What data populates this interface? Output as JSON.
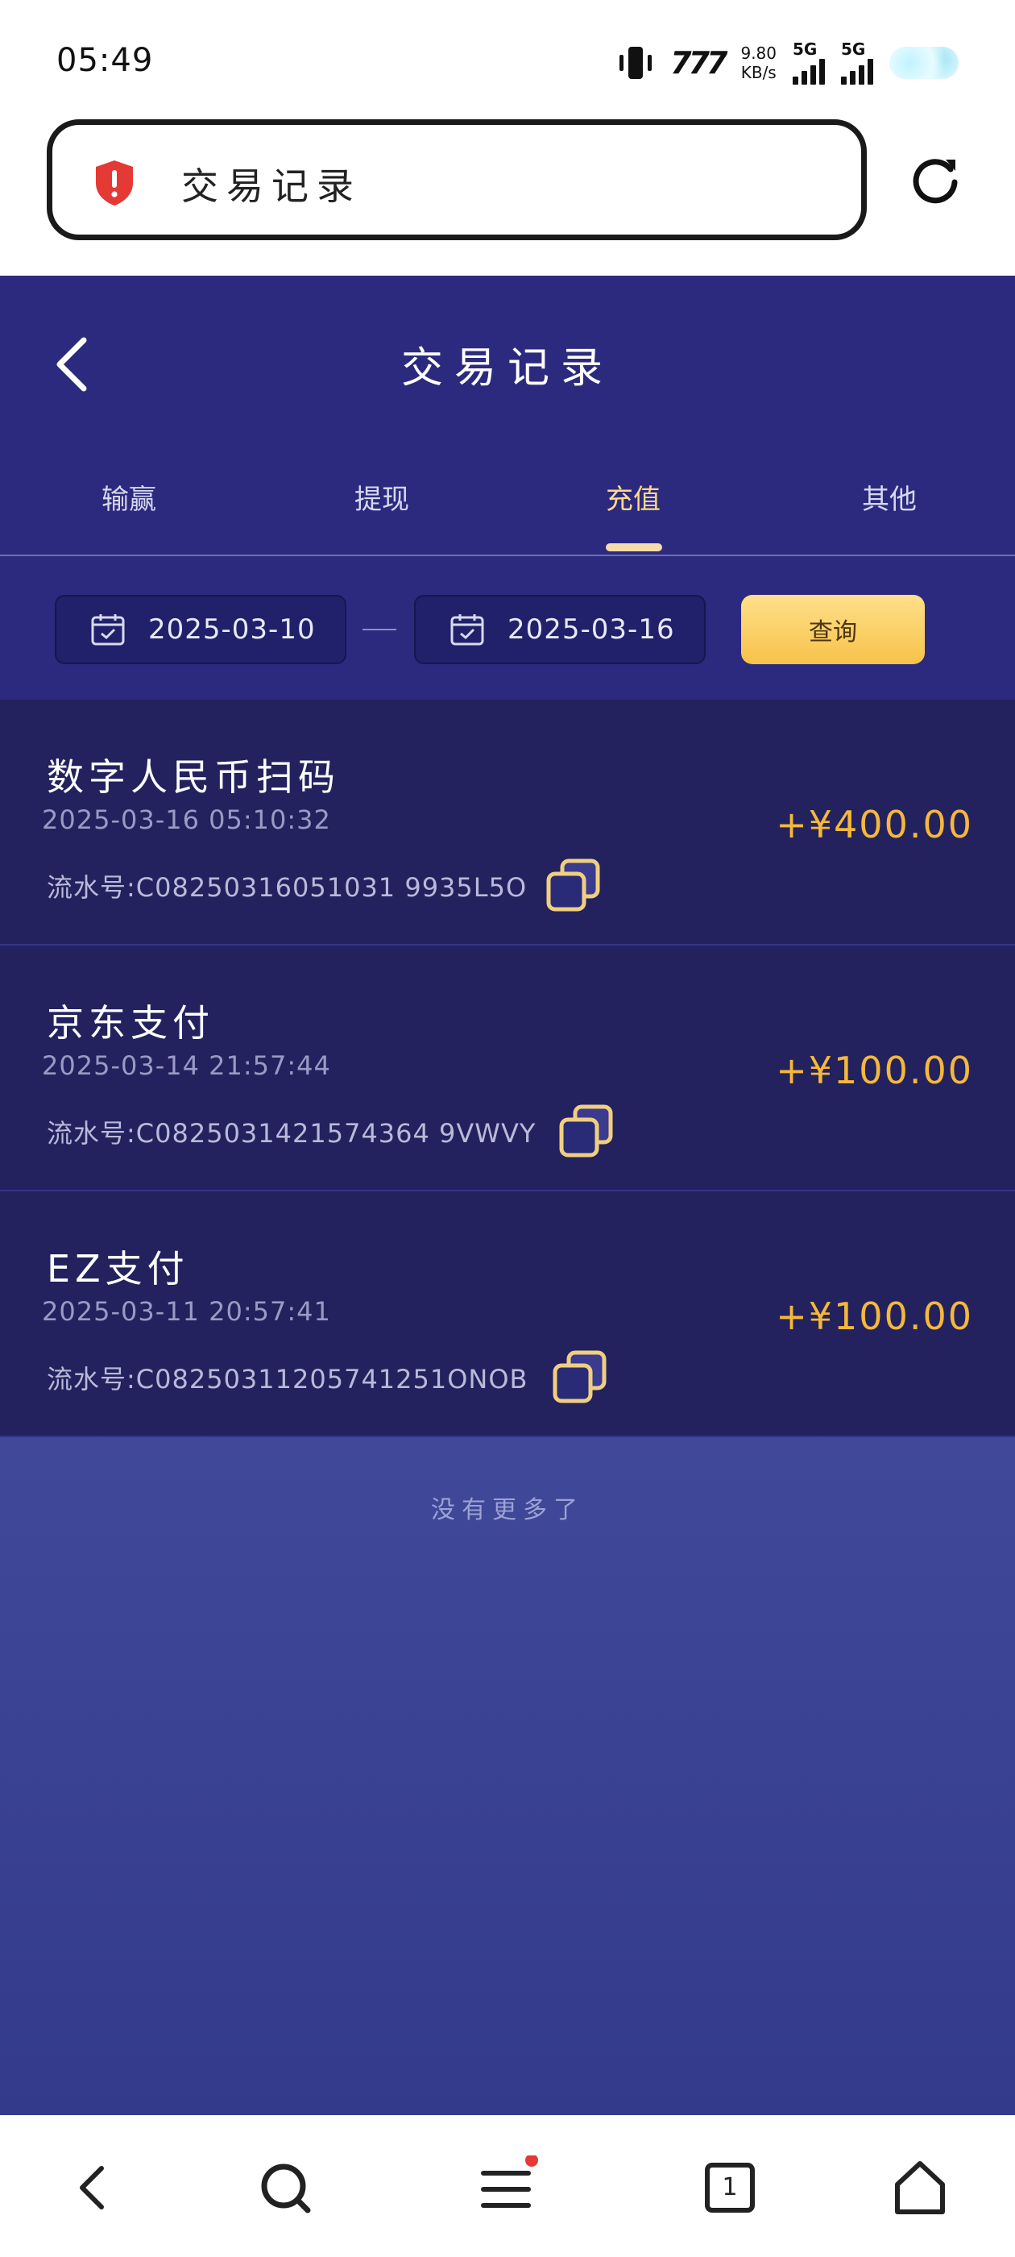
{
  "status_bar": {
    "time": "05:49",
    "network_brand": "777",
    "net_speed_value": "9.80",
    "net_speed_unit": "KB/s",
    "sim1_type": "5G",
    "sim2_type": "5G"
  },
  "browser": {
    "page_title": "交易记录",
    "shield_icon": "shield-alert-icon",
    "reload_icon": "reload-icon"
  },
  "header": {
    "title": "交易记录",
    "back_icon": "chevron-left-icon"
  },
  "tabs": [
    {
      "label": "输赢",
      "active": false
    },
    {
      "label": "提现",
      "active": false
    },
    {
      "label": "充值",
      "active": true
    },
    {
      "label": "其他",
      "active": false
    }
  ],
  "filter": {
    "start_date": "2025-03-10",
    "end_date": "2025-03-16",
    "separator": "—",
    "query_label": "查询"
  },
  "records": [
    {
      "title": "数字人民币扫码",
      "time": "2025-03-16 05:10:32",
      "serial": "流水号:C08250316051031 9935L5O",
      "amount": "+¥400.00"
    },
    {
      "title": "京东支付",
      "time": "2025-03-14 21:57:44",
      "serial": "流水号:C0825031421574364 9VWVY",
      "amount": "+¥100.00"
    },
    {
      "title": "EZ支付",
      "time": "2025-03-11 20:57:41",
      "serial": "流水号:C08250311205741251ONOB",
      "amount": "+¥100.00"
    }
  ],
  "footer_text": "没有更多了",
  "colors": {
    "primary_bg": "#2c2a7e",
    "record_bg": "#23225f",
    "accent_gold": "#f5b83a",
    "query_button": "#f7c24a"
  },
  "bottom_nav": {
    "tab_count": "1",
    "items": [
      "back-icon",
      "search-icon",
      "menu-icon",
      "tabs-icon",
      "home-icon"
    ]
  }
}
